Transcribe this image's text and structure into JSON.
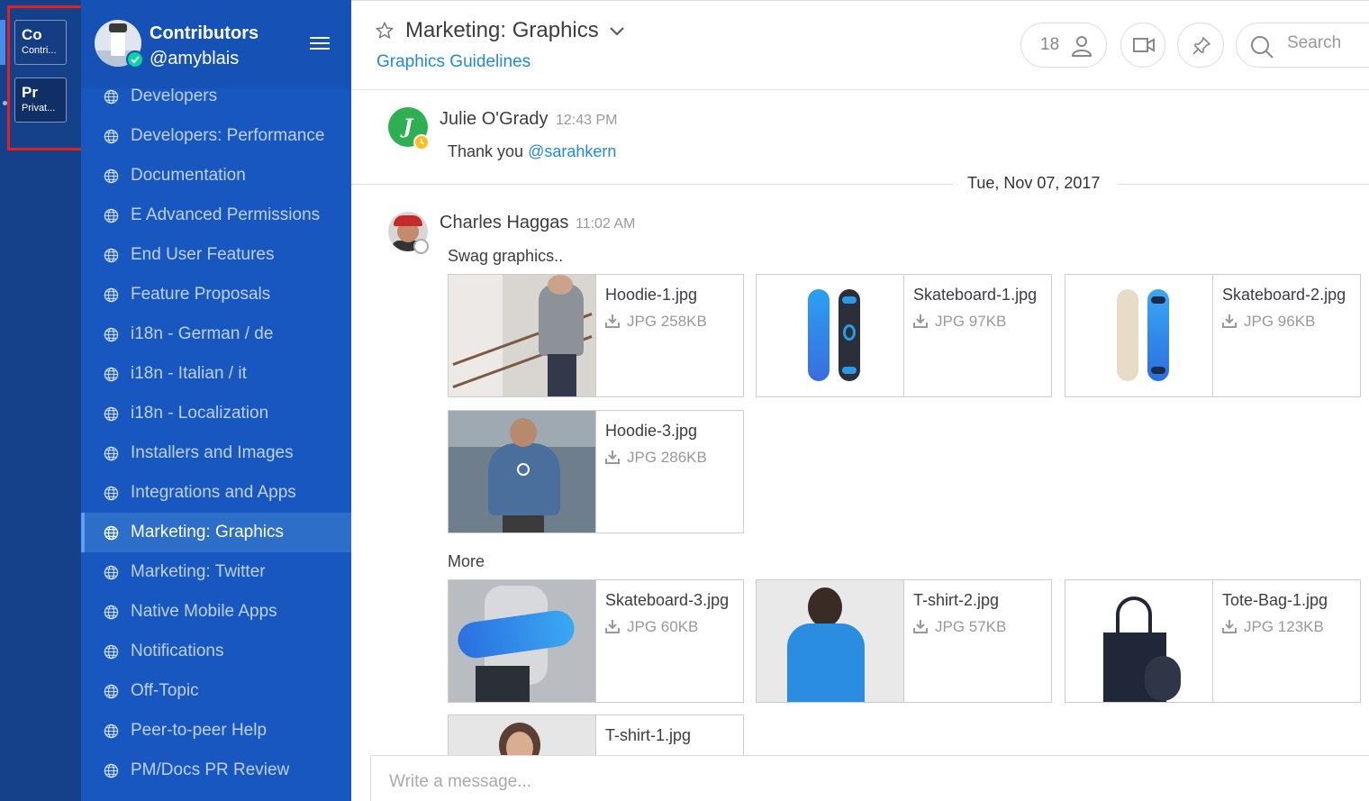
{
  "teams": [
    {
      "abbr": "Co",
      "name": "Contributors"
    },
    {
      "abbr": "Pr",
      "name": "Private Team"
    }
  ],
  "sidebar": {
    "team_name": "Contributors",
    "username": "@amyblais",
    "channels": [
      {
        "label": "Developers"
      },
      {
        "label": "Developers: Performance"
      },
      {
        "label": "Documentation"
      },
      {
        "label": "E Advanced Permissions"
      },
      {
        "label": "End User Features"
      },
      {
        "label": "Feature Proposals"
      },
      {
        "label": "i18n - German / de"
      },
      {
        "label": "i18n - Italian / it"
      },
      {
        "label": "i18n - Localization"
      },
      {
        "label": "Installers and Images"
      },
      {
        "label": "Integrations and Apps"
      },
      {
        "label": "Marketing: Graphics"
      },
      {
        "label": "Marketing: Twitter"
      },
      {
        "label": "Native Mobile Apps"
      },
      {
        "label": "Notifications"
      },
      {
        "label": "Off-Topic"
      },
      {
        "label": "Peer-to-peer Help"
      },
      {
        "label": "PM/Docs PR Review"
      }
    ],
    "active_channel_index": 11
  },
  "header": {
    "channel_name": "Marketing: Graphics",
    "header_link": "Graphics Guidelines",
    "member_count": "18",
    "search_placeholder": "Search"
  },
  "posts": [
    {
      "author": "Julie O'Grady",
      "avatar_letter": "J",
      "time": "12:43 PM",
      "text_prefix": "Thank you ",
      "mention": "@sarahkern"
    },
    {
      "author": "Charles Haggas",
      "time": "11:02 AM",
      "text": "Swag graphics.."
    }
  ],
  "date_separator": "Tue, Nov 07, 2017",
  "more_label": "More",
  "attachments": [
    {
      "name": "Hoodie-1.jpg",
      "meta": "JPG 258KB"
    },
    {
      "name": "Skateboard-1.jpg",
      "meta": "JPG 97KB"
    },
    {
      "name": "Skateboard-2.jpg",
      "meta": "JPG 96KB"
    },
    {
      "name": "Hoodie-3.jpg",
      "meta": "JPG 286KB"
    },
    {
      "name": "Skateboard-3.jpg",
      "meta": "JPG 60KB"
    },
    {
      "name": "T-shirt-2.jpg",
      "meta": "JPG 57KB"
    },
    {
      "name": "Tote-Bag-1.jpg",
      "meta": "JPG 123KB"
    },
    {
      "name": "T-shirt-1.jpg",
      "meta": ""
    }
  ],
  "composer": {
    "placeholder": "Write a message..."
  },
  "colors": {
    "team_sidebar": "#14418a",
    "channel_sidebar": "#1857bf",
    "active_channel": "#2d6ec9",
    "link": "#2389d7",
    "online": "#06d6a0",
    "away": "#ffbc1f",
    "highlight_frame": "#e41f1f"
  }
}
